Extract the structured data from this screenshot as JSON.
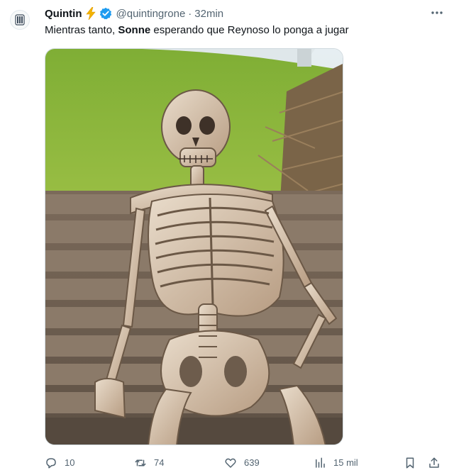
{
  "tweet": {
    "author": {
      "display_name": "Quintin",
      "handle": "@quintingrone",
      "verified": true,
      "emoji_icon": "lightning-bolt-icon"
    },
    "separator": "·",
    "time": "32min",
    "text": {
      "before": "Mientras tanto, ",
      "bold": "Sonne",
      "after": " esperando que Reynoso lo ponga a jugar"
    },
    "media": {
      "kind": "image",
      "description_icon": "waiting-skeleton-meme-image"
    },
    "actions": {
      "reply_count": "10",
      "retweet_count": "74",
      "like_count": "639",
      "views_count": "15 mil"
    }
  },
  "colors": {
    "text_primary": "#0f1419",
    "text_secondary": "#536471",
    "verified_blue": "#1d9bf0",
    "bolt_yellow": "#f4b400"
  }
}
